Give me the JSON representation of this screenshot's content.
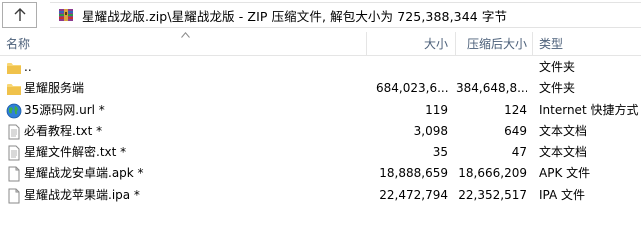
{
  "address": {
    "path": "星耀战龙版.zip\\星耀战龙版 - ZIP 压缩文件, 解包大小为 725,388,344 字节"
  },
  "columns": {
    "name": "名称",
    "size": "大小",
    "packed": "压缩后大小",
    "type": "类型"
  },
  "files": [
    {
      "name": "..",
      "size": "",
      "packed": "",
      "type": "文件夹",
      "icon": "folder-icon"
    },
    {
      "name": "星耀服务端",
      "size": "684,023,6...",
      "packed": "384,648,8...",
      "type": "文件夹",
      "icon": "folder-icon"
    },
    {
      "name": "35源码网.url *",
      "size": "119",
      "packed": "124",
      "type": "Internet 快捷方式",
      "icon": "globe-icon"
    },
    {
      "name": "必看教程.txt *",
      "size": "3,098",
      "packed": "649",
      "type": "文本文档",
      "icon": "text-file-icon"
    },
    {
      "name": "星耀文件解密.txt *",
      "size": "35",
      "packed": "47",
      "type": "文本文档",
      "icon": "text-file-icon"
    },
    {
      "name": "星耀战龙安卓端.apk *",
      "size": "18,888,659",
      "packed": "18,666,209",
      "type": "APK 文件",
      "icon": "file-icon"
    },
    {
      "name": "星耀战龙苹果端.ipa *",
      "size": "22,472,794",
      "packed": "22,352,517",
      "type": "IPA 文件",
      "icon": "file-icon"
    }
  ]
}
